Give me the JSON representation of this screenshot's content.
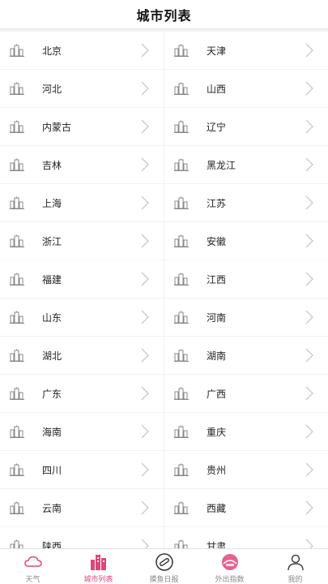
{
  "header": {
    "title": "城市列表"
  },
  "cities": [
    [
      "北京",
      "天津"
    ],
    [
      "河北",
      "山西"
    ],
    [
      "内蒙古",
      "辽宁"
    ],
    [
      "吉林",
      "黑龙江"
    ],
    [
      "上海",
      "江苏"
    ],
    [
      "浙江",
      "安徽"
    ],
    [
      "福建",
      "江西"
    ],
    [
      "山东",
      "河南"
    ],
    [
      "湖北",
      "湖南"
    ],
    [
      "广东",
      "广西"
    ],
    [
      "海南",
      "重庆"
    ],
    [
      "四川",
      "贵州"
    ],
    [
      "云南",
      "西藏"
    ],
    [
      "陕西",
      "甘肃"
    ]
  ],
  "tabs": [
    {
      "label": "天气",
      "icon": "cloud-icon",
      "active": false
    },
    {
      "label": "城市列表",
      "icon": "city-buildings-icon",
      "active": true
    },
    {
      "label": "摸鱼日报",
      "icon": "report-badge-icon",
      "active": false
    },
    {
      "label": "外出指数",
      "icon": "outing-dome-icon",
      "active": false
    },
    {
      "label": "我的",
      "icon": "user-icon",
      "active": false
    }
  ],
  "colors": {
    "accent": "#e0457b",
    "icon_gray": "#888888",
    "chevron": "#c8c8c8"
  }
}
